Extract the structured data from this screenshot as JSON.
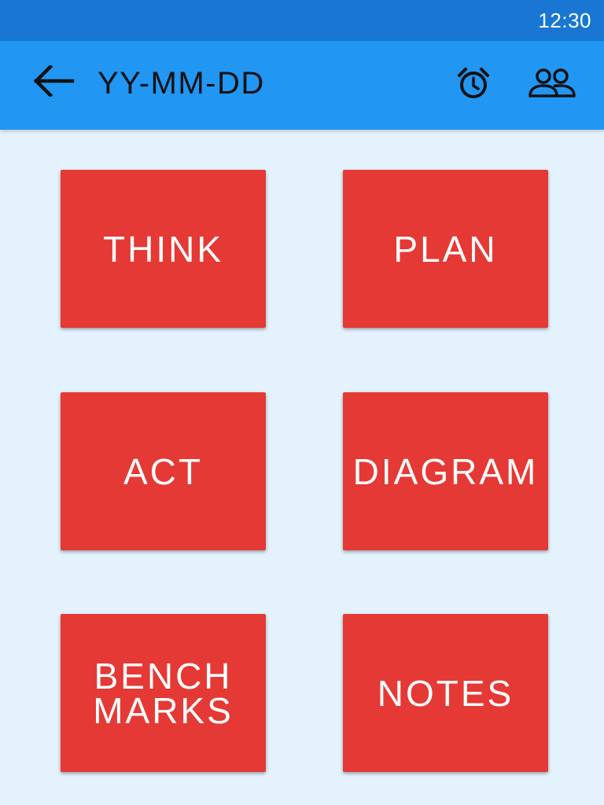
{
  "status_bar": {
    "time": "12:30"
  },
  "app_bar": {
    "title": "YY-MM-DD",
    "back_icon": "arrow-back-icon",
    "alarm_icon": "alarm-clock-icon",
    "group_icon": "group-icon"
  },
  "tiles": [
    {
      "label": "THINK"
    },
    {
      "label": "PLAN"
    },
    {
      "label": "ACT"
    },
    {
      "label": "DIAGRAM"
    },
    {
      "label": "BENCH\nMARKS"
    },
    {
      "label": "NOTES"
    }
  ],
  "colors": {
    "status_bar": "#1976d2",
    "app_bar": "#2196f3",
    "background": "#e3f2fd",
    "tile": "#e53935",
    "tile_text": "#ffffff"
  }
}
